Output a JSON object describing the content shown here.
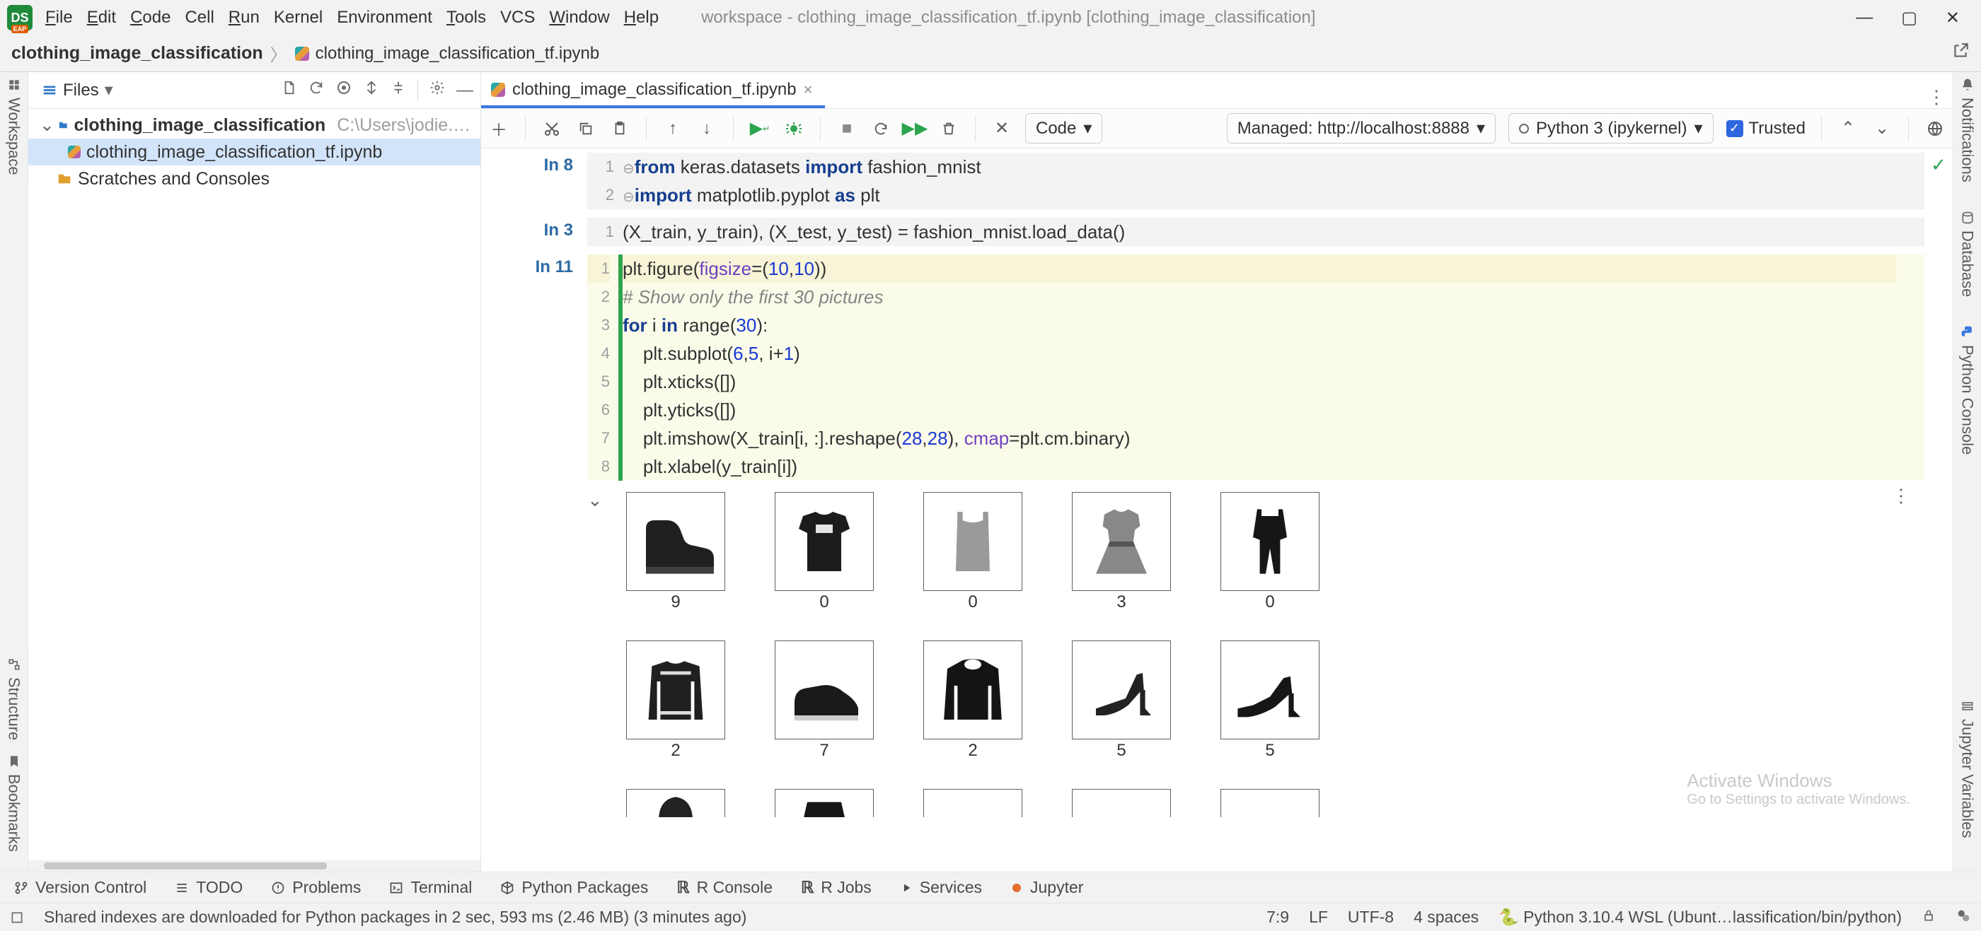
{
  "titlebar": {
    "logo": "DS",
    "menu": [
      "File",
      "Edit",
      "Code",
      "Cell",
      "Run",
      "Kernel",
      "Environment",
      "Tools",
      "VCS",
      "Window",
      "Help"
    ],
    "title": "workspace - clothing_image_classification_tf.ipynb [clothing_image_classification]"
  },
  "breadcrumbs": {
    "project": "clothing_image_classification",
    "file": "clothing_image_classification_tf.ipynb"
  },
  "project_panel": {
    "selector_label": "Files",
    "root": {
      "name": "clothing_image_classification",
      "path": "C:\\Users\\jodie.burchell\\DLP"
    },
    "file": "clothing_image_classification_tf.ipynb",
    "scratches": "Scratches and Consoles"
  },
  "left_rail": {
    "workspace": "Workspace",
    "structure": "Structure",
    "bookmarks": "Bookmarks"
  },
  "right_rail": {
    "notifications": "Notifications",
    "database": "Database",
    "python_console": "Python Console",
    "jupyter_vars": "Jupyter Variables"
  },
  "tab": {
    "name": "clothing_image_classification_tf.ipynb"
  },
  "nb_toolbar": {
    "type_label": "Code",
    "managed_label": "Managed: http://localhost:8888",
    "kernel_label": "Python 3 (ipykernel)",
    "trusted_label": "Trusted"
  },
  "cells": {
    "c1": {
      "prompt": "In 8",
      "lines": {
        "l1a": "from",
        "l1b": " keras.datasets ",
        "l1c": "import",
        "l1d": " fashion_mnist",
        "l2a": "import",
        "l2b": " matplotlib.pyplot ",
        "l2c": "as",
        "l2d": " plt"
      }
    },
    "c2": {
      "prompt": "In 3",
      "line": "(X_train, y_train), (X_test, y_test) = fashion_mnist.load_data()"
    },
    "c3": {
      "prompt": "In 11",
      "lines": {
        "l1": {
          "a": "plt.figure(",
          "b": "figsize",
          "c": "=(",
          "d": "10",
          "e": ",",
          "f": "10",
          "g": "))"
        },
        "l2": "# Show only the first 30 pictures",
        "l3": {
          "a": "for",
          "b": " i ",
          "c": "in",
          "d": " range(",
          "e": "30",
          "f": "):"
        },
        "l4": {
          "a": "    plt.subplot(",
          "b": "6",
          "c": ",",
          "d": "5",
          "e": ", i+",
          "f": "1",
          "g": ")"
        },
        "l5": "    plt.xticks([])",
        "l6": "    plt.yticks([])",
        "l7": {
          "a": "    plt.imshow(X_train[i, :].reshape(",
          "b": "28",
          "c": ",",
          "d": "28",
          "e": "), ",
          "f": "cmap",
          "g": "=plt.cm.binary)"
        },
        "l8": "    plt.xlabel(y_train[i])"
      }
    }
  },
  "output": {
    "labels_row1": [
      "9",
      "0",
      "0",
      "3",
      "0"
    ],
    "labels_row2": [
      "2",
      "7",
      "2",
      "5",
      "5"
    ]
  },
  "toolwins": {
    "version_control": "Version Control",
    "todo": "TODO",
    "problems": "Problems",
    "terminal": "Terminal",
    "py_pkgs": "Python Packages",
    "r_console": "R Console",
    "r_jobs": "R Jobs",
    "services": "Services",
    "jupyter": "Jupyter"
  },
  "watermark": {
    "main": "Activate Windows",
    "sub": "Go to Settings to activate Windows."
  },
  "statusbar": {
    "msg": "Shared indexes are downloaded for Python packages in 2 sec, 593 ms (2.46 MB) (3 minutes ago)",
    "pos": "7:9",
    "sep": "LF",
    "enc": "UTF-8",
    "indent": "4 spaces",
    "interp": "Python 3.10.4 WSL (Ubunt…lassification/bin/python)"
  }
}
